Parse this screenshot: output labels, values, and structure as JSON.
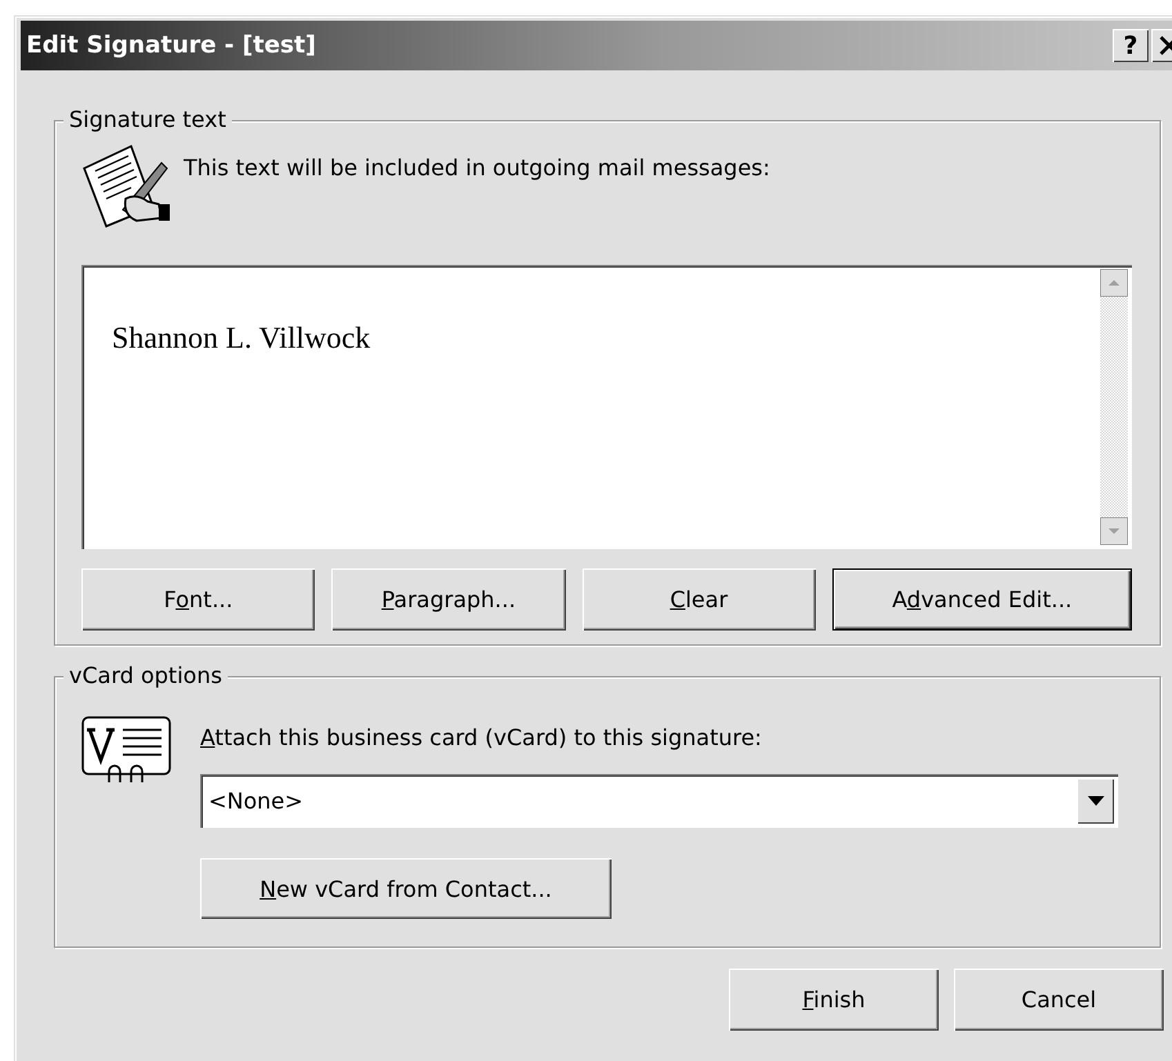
{
  "window": {
    "title": "Edit Signature - [test]",
    "help": "?"
  },
  "signature_group": {
    "legend": "Signature text",
    "prompt": "This text will be included in outgoing mail messages:",
    "signature": "Shannon L. Villwock",
    "buttons": [
      {
        "before": "F",
        "key": "o",
        "after": "nt...",
        "default": false
      },
      {
        "key": "P",
        "after": "aragraph...",
        "default": false
      },
      {
        "key": "C",
        "after": "lear",
        "default": false
      },
      {
        "before": "A",
        "key": "d",
        "after": "vanced Edit...",
        "default": true
      }
    ]
  },
  "vcard_group": {
    "legend": "vCard options",
    "label": {
      "key": "A",
      "after": "ttach this business card (vCard) to this signature:"
    },
    "dropdown": {
      "value": "<None>"
    },
    "button": {
      "key": "N",
      "after": "ew vCard from Contact...",
      "default": false
    }
  },
  "footer_buttons": [
    {
      "key": "F",
      "after": "inish",
      "default": false
    },
    {
      "label": "Cancel",
      "default": false
    }
  ]
}
